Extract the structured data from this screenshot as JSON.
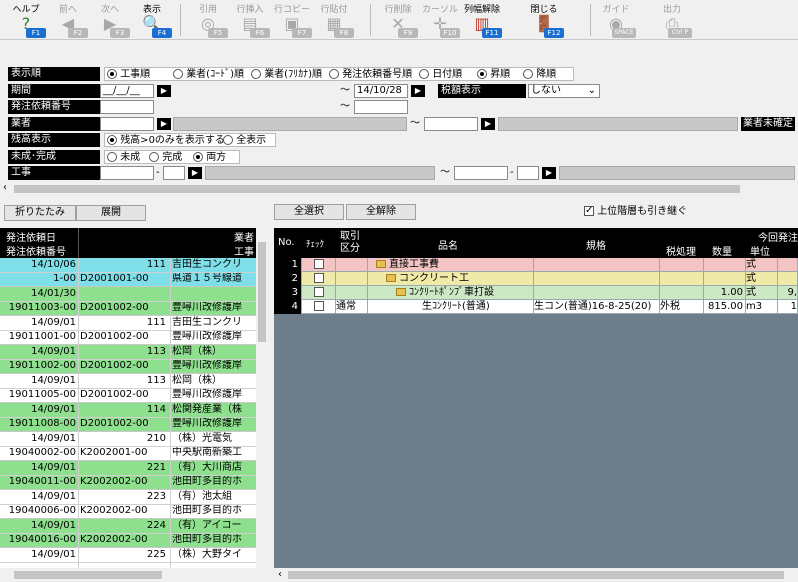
{
  "toolbar": {
    "buttons": [
      {
        "label": "ヘルプ",
        "key": "F1",
        "icon": "help-icon",
        "enabled": true
      },
      {
        "label": "前へ",
        "key": "F2",
        "icon": "arrow-left-icon",
        "enabled": false
      },
      {
        "label": "次へ",
        "key": "F3",
        "icon": "arrow-right-icon",
        "enabled": false
      },
      {
        "label": "表示",
        "key": "F4",
        "icon": "magnifier-icon",
        "enabled": true
      },
      {
        "label": "引用",
        "key": "F5",
        "icon": "quote-icon",
        "enabled": false
      },
      {
        "label": "行挿入",
        "key": "F6",
        "icon": "insert-row-icon",
        "enabled": false
      },
      {
        "label": "行コピー",
        "key": "F7",
        "icon": "copy-row-icon",
        "enabled": false
      },
      {
        "label": "行貼付",
        "key": "F8",
        "icon": "paste-row-icon",
        "enabled": false
      },
      {
        "label": "行削除",
        "key": "F9",
        "icon": "delete-row-icon",
        "enabled": false
      },
      {
        "label": "カーソル",
        "key": "F10",
        "icon": "cursor-icon",
        "enabled": false
      },
      {
        "label": "列幅解除",
        "key": "F11",
        "icon": "column-width-icon",
        "enabled": true
      },
      {
        "label": "閉じる",
        "key": "F12",
        "icon": "door-close-icon",
        "enabled": true
      },
      {
        "label": "ガイド",
        "key": "SPACE",
        "icon": "guide-icon",
        "enabled": false
      },
      {
        "label": "出力",
        "key": "Ctrl P",
        "icon": "print-icon",
        "enabled": false
      }
    ]
  },
  "filters": {
    "sort_label": "表示順",
    "sort_options": [
      "工事順",
      "業者(ｺｰﾄﾞ)順",
      "業者(ﾌﾘｶﾅ)順",
      "発注依頼番号順",
      "日付順"
    ],
    "order_options": [
      "昇順",
      "降順"
    ],
    "period_label": "期間",
    "period_from": "__/__/__",
    "period_to": "14/10/28",
    "tax_label": "税額表示",
    "tax_value": "しない",
    "order_no_label": "発注依頼番号",
    "vendor_label": "業者",
    "vendor_unconfirmed": "業者未確定",
    "balance_label": "残高表示",
    "balance_options": [
      "残高>0のみを表示する",
      "全表示"
    ],
    "status_label": "未成･完成",
    "status_options": [
      "未成",
      "完成",
      "両方"
    ],
    "project_label": "工事",
    "tilde": "～",
    "dash": "-"
  },
  "actions": {
    "collapse": "折りたたみ",
    "expand": "展開",
    "select_all": "全選択",
    "deselect_all": "全解除",
    "inherit_label": "上位階層も引き継ぐ"
  },
  "left_grid": {
    "headers": {
      "date": "発注依頼日",
      "vendor": "業者",
      "order_no": "発注依頼番号",
      "project": "工事"
    },
    "rows": [
      {
        "date": "14/10/06",
        "code": "111",
        "vendor": "吉田生コンクリ",
        "order_no": "1-00",
        "proj_code": "D2001001-00",
        "project": "県道１５号線道",
        "color": "#7fdfe8"
      },
      {
        "date": "14/01/30",
        "code": "",
        "vendor": "",
        "order_no": "19011003-00",
        "proj_code": "D2001002-00",
        "project": "豊噚川改修護岸",
        "color": "#8ee08e"
      },
      {
        "date": "14/09/01",
        "code": "111",
        "vendor": "吉田生コンクリ",
        "order_no": "19011001-00",
        "proj_code": "D2001002-00",
        "project": "豊噚川改修護岸",
        "color": "#ffffff"
      },
      {
        "date": "14/09/01",
        "code": "113",
        "vendor": "松岡（株）",
        "order_no": "19011002-00",
        "proj_code": "D2001002-00",
        "project": "豊噚川改修護岸",
        "color": "#8ee08e"
      },
      {
        "date": "14/09/01",
        "code": "113",
        "vendor": "松岡（株）",
        "order_no": "19011005-00",
        "proj_code": "D2001002-00",
        "project": "豊噚川改修護岸",
        "color": "#ffffff"
      },
      {
        "date": "14/09/01",
        "code": "114",
        "vendor": "松関発産業（株",
        "order_no": "19011008-00",
        "proj_code": "D2001002-00",
        "project": "豊噚川改修護岸",
        "color": "#8ee08e"
      },
      {
        "date": "14/09/01",
        "code": "210",
        "vendor": "（株）光電気",
        "order_no": "19040002-00",
        "proj_code": "K2002001-00",
        "project": "中央駅南新築工",
        "color": "#ffffff"
      },
      {
        "date": "14/09/01",
        "code": "221",
        "vendor": "（有）大川商店",
        "order_no": "19040011-00",
        "proj_code": "K2002002-00",
        "project": "池田町多目的ホ",
        "color": "#8ee08e"
      },
      {
        "date": "14/09/01",
        "code": "223",
        "vendor": "（有）池太組",
        "order_no": "19040006-00",
        "proj_code": "K2002002-00",
        "project": "池田町多目的ホ",
        "color": "#ffffff"
      },
      {
        "date": "14/09/01",
        "code": "224",
        "vendor": "（有）アイコー",
        "order_no": "19040016-00",
        "proj_code": "K2002002-00",
        "project": "池田町多目的ホ",
        "color": "#8ee08e"
      },
      {
        "date": "14/09/01",
        "code": "225",
        "vendor": "（株）大野タイ",
        "order_no": "",
        "proj_code": "",
        "project": "",
        "color": "#ffffff"
      }
    ]
  },
  "right_grid": {
    "headers": {
      "no": "No.",
      "check": "ﾁｪｯｸ",
      "kubun": "取引区分",
      "name": "品名",
      "spec": "規格",
      "tax": "税処理",
      "qty": "数量",
      "unit": "単位",
      "current": "今回発注"
    },
    "rows": [
      {
        "no": "1",
        "kubun": "",
        "name": "直接工事費",
        "level": 0,
        "spec": "",
        "tax": "",
        "qty": "",
        "unit": "式",
        "extra": "",
        "color": "#f2c4c4"
      },
      {
        "no": "2",
        "kubun": "",
        "name": "コンクリート工",
        "level": 1,
        "spec": "",
        "tax": "",
        "qty": "",
        "unit": "式",
        "extra": "",
        "color": "#f0eaa8"
      },
      {
        "no": "3",
        "kubun": "",
        "name": "ｺﾝｸﾘｰﾄﾎﾟﾝﾌﾟ車打設",
        "level": 2,
        "spec": "",
        "tax": "",
        "qty": "1.00",
        "unit": "式",
        "extra": "9,",
        "color": "#cde8c4"
      },
      {
        "no": "4",
        "kubun": "通常",
        "name": "生ｺﾝｸﾘｰﾄ(普通)",
        "level": 3,
        "spec": "生コン(普通)16-8-25(20)",
        "tax": "外税",
        "qty": "815.00",
        "unit": "m3",
        "extra": "1",
        "color": "#ffffff"
      }
    ]
  }
}
